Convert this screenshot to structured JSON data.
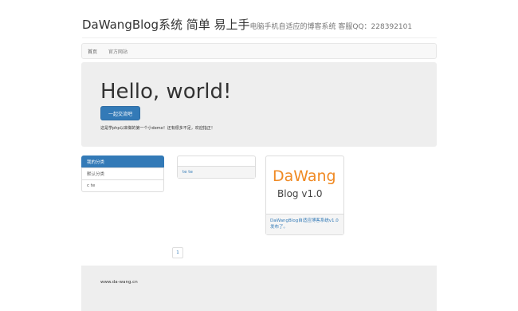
{
  "header": {
    "title": "DaWangBlog系统 简单 易上手",
    "subtitle": "电脑手机自适应的博客系统 客服QQ：228392101"
  },
  "nav": {
    "items": [
      "首页",
      "官方网站"
    ]
  },
  "jumbotron": {
    "heading": "Hello, world!",
    "button_label": "一起交流吧",
    "description": "这是学php以来做的第一个小demo！还有很多不足，欢迎指正！"
  },
  "categories": {
    "items": [
      "我的分类",
      "默认分类",
      "c te"
    ]
  },
  "post_panel": {
    "link": "te te"
  },
  "thumbnail": {
    "logo_line1": "DaWang",
    "logo_line2": "Blog   v1.0",
    "caption": "DaWangBlog自适应博客系统v1.0发布了。"
  },
  "pagination": {
    "current": "1"
  },
  "footer": {
    "text": "www.da-wang.cn"
  },
  "colors": {
    "primary": "#337ab7",
    "logo_orange": "#f08a24",
    "jumbotron_bg": "#eeeeee"
  }
}
